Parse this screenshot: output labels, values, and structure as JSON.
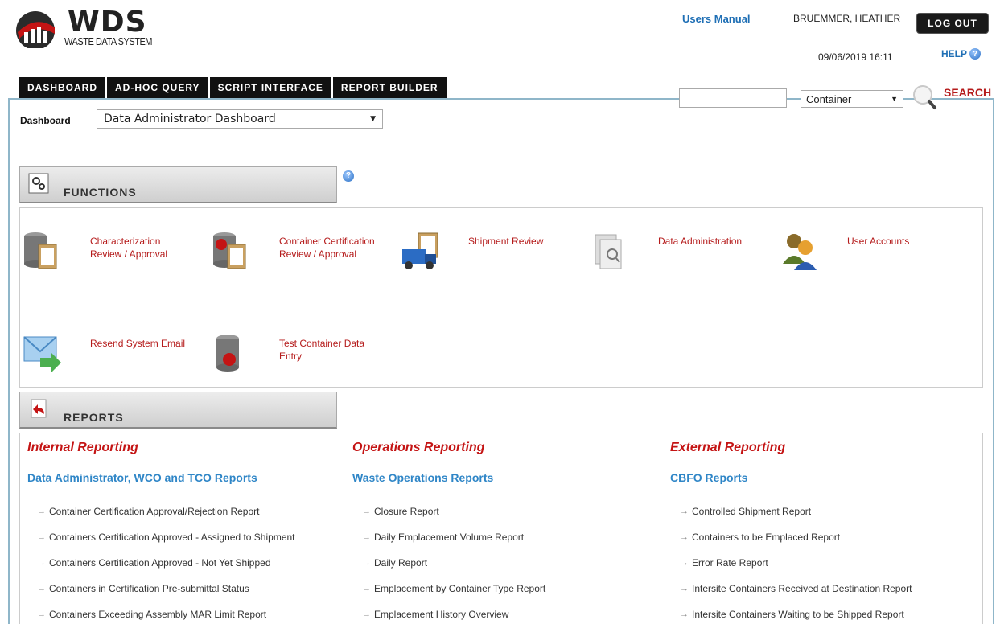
{
  "header": {
    "logo_title": "WDS",
    "logo_subtitle": "WASTE DATA SYSTEM",
    "users_manual": "Users Manual",
    "username": "BRUEMMER, HEATHER",
    "logout": "LOG OUT",
    "datetime": "09/06/2019 16:11",
    "help": "HELP"
  },
  "nav": {
    "tabs": [
      "DASHBOARD",
      "AD-HOC QUERY",
      "SCRIPT INTERFACE",
      "REPORT BUILDER"
    ]
  },
  "search": {
    "input_value": "",
    "type_selected": "Container",
    "button_label": "SEARCH"
  },
  "dashboard": {
    "label": "Dashboard",
    "selected": "Data Administrator Dashboard"
  },
  "functions": {
    "title": "FUNCTIONS",
    "items": [
      {
        "label": "Characterization Review / Approval",
        "icon": "database-clipboard-icon"
      },
      {
        "label": "Container Certification Review / Approval",
        "icon": "database-certificate-icon"
      },
      {
        "label": "Shipment Review",
        "icon": "truck-icon"
      },
      {
        "label": "Data Administration",
        "icon": "document-search-icon"
      },
      {
        "label": "User Accounts",
        "icon": "users-icon"
      },
      {
        "label": "Resend System Email",
        "icon": "email-forward-icon"
      },
      {
        "label": "Test Container Data Entry",
        "icon": "database-seal-icon"
      }
    ]
  },
  "reports": {
    "title": "REPORTS",
    "columns": [
      {
        "heading": "Internal Reporting",
        "subheading": "Data Administrator, WCO and TCO Reports",
        "links": [
          "Container Certification Approval/Rejection Report",
          "Containers Certification Approved - Assigned to Shipment",
          "Containers Certification Approved - Not Yet Shipped",
          "Containers in Certification Pre-submittal Status",
          "Containers Exceeding Assembly MAR Limit Report"
        ]
      },
      {
        "heading": "Operations Reporting",
        "subheading": "Waste Operations Reports",
        "links": [
          "Closure Report",
          "Daily Emplacement Volume Report",
          "Daily Report",
          "Emplacement by Container Type Report",
          "Emplacement History Overview"
        ]
      },
      {
        "heading": "External Reporting",
        "subheading": "CBFO Reports",
        "links": [
          "Controlled Shipment Report",
          "Containers to be Emplaced Report",
          "Error Rate Report",
          "Intersite Containers Received at Destination Report",
          "Intersite Containers Waiting to be Shipped Report"
        ]
      }
    ]
  },
  "colors": {
    "accent_red": "#b51b1b",
    "link_blue": "#2f86c7",
    "panel_border": "#8fb6c9"
  }
}
